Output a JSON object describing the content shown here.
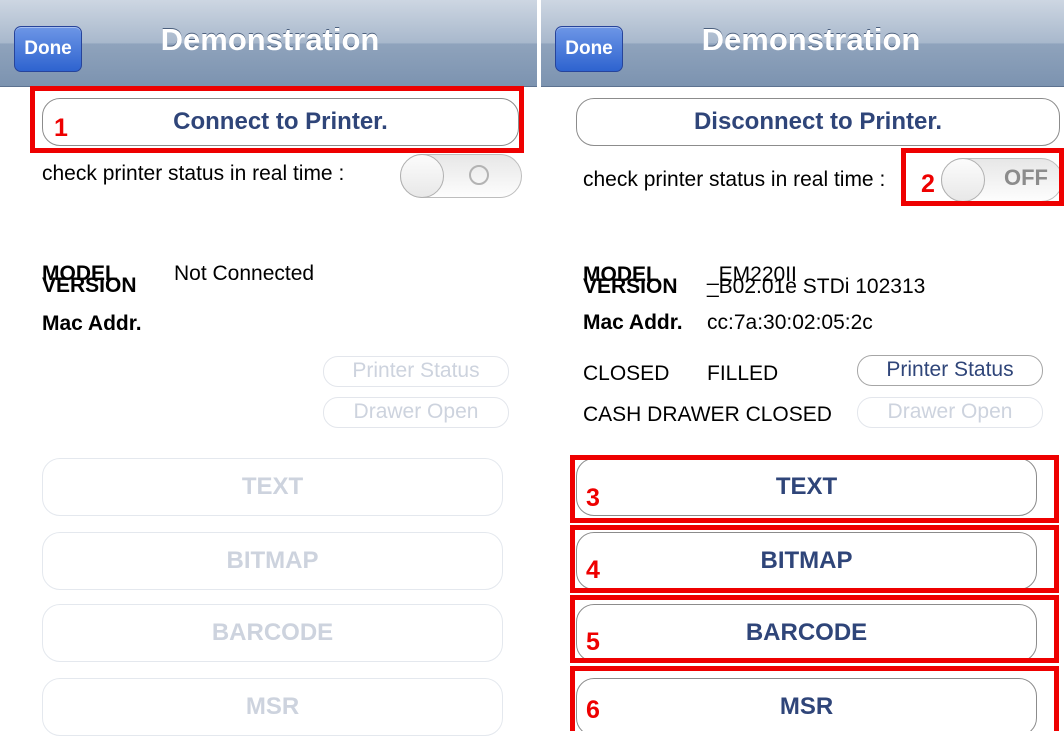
{
  "left": {
    "nav": {
      "done_label": "Done",
      "title": "Demonstration"
    },
    "connect_label": "Connect to Printer.",
    "realtime_label": "check printer status in real time :",
    "info": {
      "model_label": "MODEL",
      "model_value": "Not Connected",
      "version_label": "VERSION",
      "mac_label": "Mac Addr."
    },
    "printer_status_label": "Printer Status",
    "drawer_open_label": "Drawer Open",
    "actions": [
      "TEXT",
      "BITMAP",
      "BARCODE",
      "MSR"
    ],
    "annotation": "1"
  },
  "right": {
    "nav": {
      "done_label": "Done",
      "title": "Demonstration"
    },
    "disconnect_label": "Disconnect to Printer.",
    "realtime_label": "check printer status in real time :",
    "toggle_text": "OFF",
    "info": {
      "model_label": "MODEL",
      "model_value": "_EM220II",
      "version_label": "VERSION",
      "version_value": "_B02.01e STDi 102313",
      "mac_label": "Mac Addr.",
      "mac_value": "cc:7a:30:02:05:2c"
    },
    "cover_status": "CLOSED",
    "paper_status": "FILLED",
    "drawer_status": "CASH DRAWER CLOSED",
    "printer_status_label": "Printer Status",
    "drawer_open_label": "Drawer Open",
    "actions": [
      "TEXT",
      "BITMAP",
      "BARCODE",
      "MSR"
    ],
    "annotations": [
      "2",
      "3",
      "4",
      "5",
      "6"
    ]
  },
  "colors": {
    "annotation_red": "#ee0000",
    "button_text": "#2f4579",
    "done_blue": "#2e63cf"
  }
}
